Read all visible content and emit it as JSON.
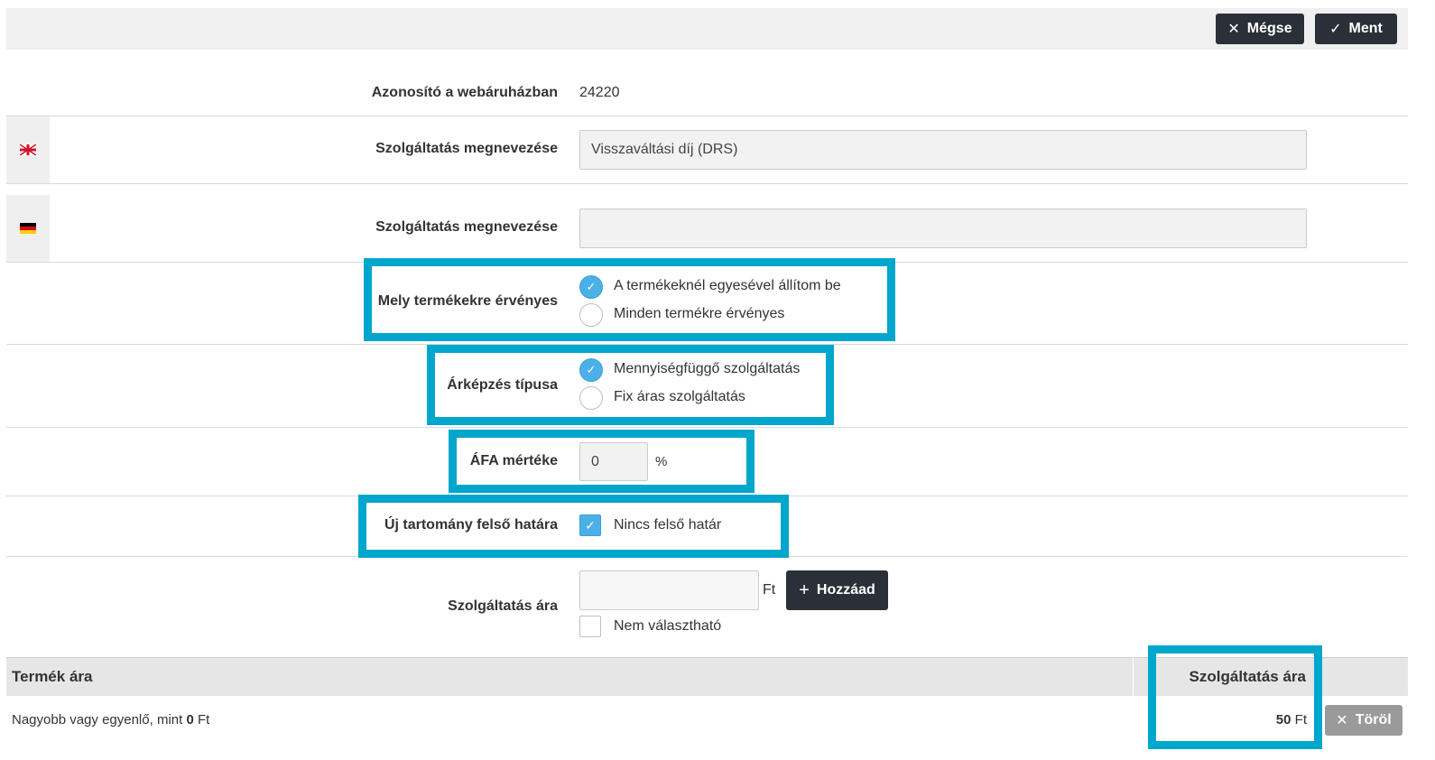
{
  "toolbar": {
    "cancel_label": "Mégse",
    "save_label": "Ment"
  },
  "webshop_id": {
    "label": "Azonosító a webáruházban",
    "value": "24220"
  },
  "name_en": {
    "label": "Szolgáltatás megnevezése",
    "value": "Visszaváltási díj (DRS)"
  },
  "name_de": {
    "label": "Szolgáltatás megnevezése",
    "value": ""
  },
  "applies_to": {
    "label": "Mely termékekre érvényes",
    "options": [
      "A termékeknél egyesével állítom be",
      "Minden termékre érvényes"
    ],
    "selected": 0
  },
  "pricing_type": {
    "label": "Árképzés típusa",
    "options": [
      "Mennyiségfüggő szolgáltatás",
      "Fix áras szolgáltatás"
    ],
    "selected": 0
  },
  "vat": {
    "label": "ÁFA mértéke",
    "value": "0",
    "unit": "%"
  },
  "upper_bound": {
    "label": "Új tartomány felső határa",
    "checkbox_label": "Nincs felső határ",
    "checked": true
  },
  "service_price": {
    "label": "Szolgáltatás ára",
    "value": "",
    "unit": "Ft",
    "add_label": "Hozzáad",
    "not_selectable_label": "Nem választható",
    "not_selectable_checked": false
  },
  "table": {
    "columns": [
      "Termék ára",
      "Szolgáltatás ára"
    ],
    "rows": [
      {
        "condition_prefix": "Nagyobb vagy egyenlő, mint",
        "condition_value": "0",
        "condition_unit": "Ft",
        "price": "50",
        "price_unit": "Ft",
        "delete_label": "Töröl"
      }
    ]
  },
  "colors": {
    "dark_button": "#2b3038",
    "highlight": "#00a6cc",
    "radio_selected": "#4cb0e8",
    "delete_button": "#9a9a9a"
  }
}
